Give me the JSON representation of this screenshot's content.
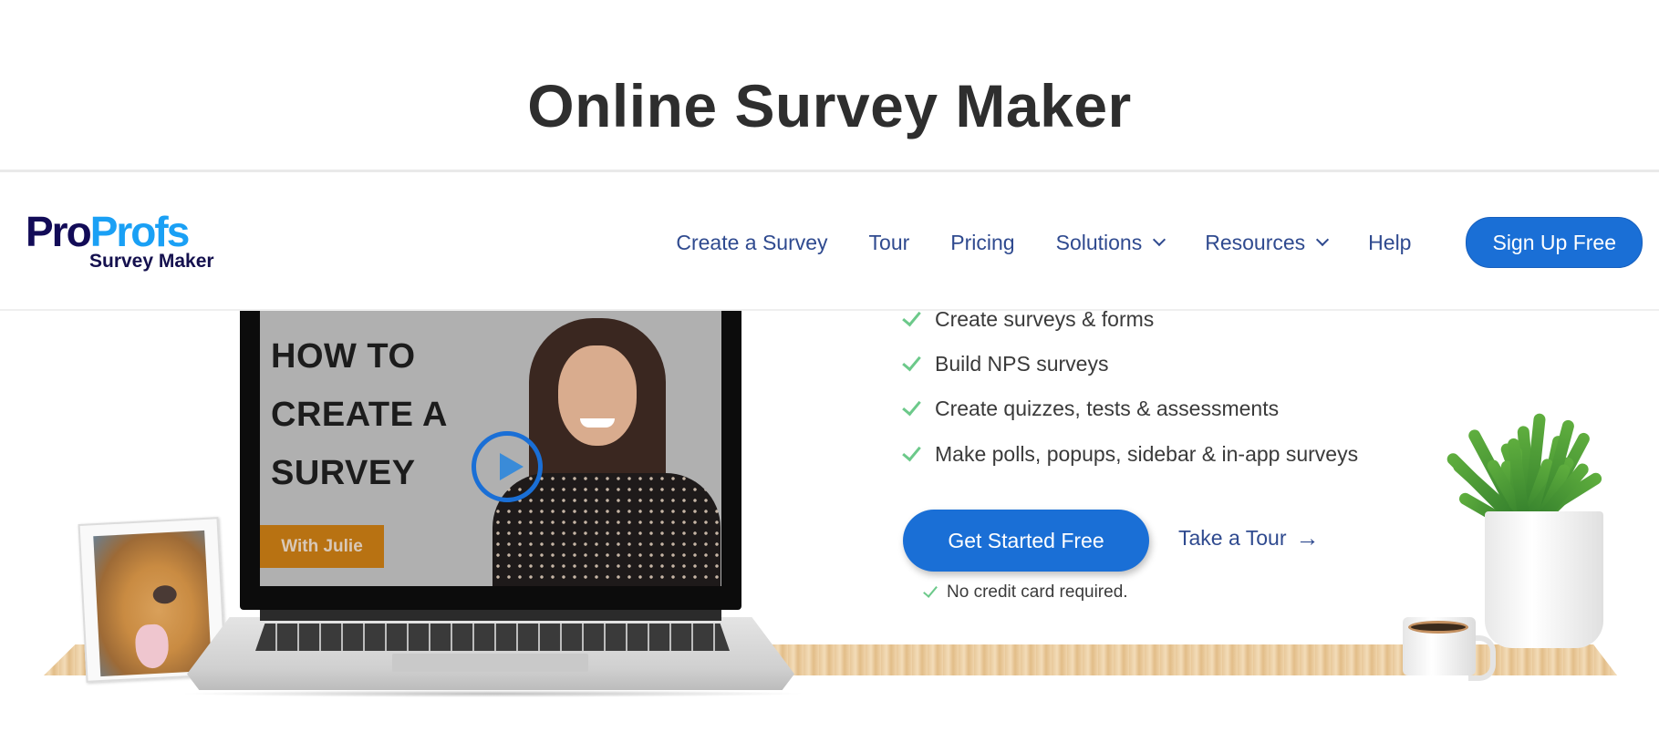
{
  "page": {
    "title": "Online Survey Maker"
  },
  "header": {
    "logo": {
      "part1": "Pro",
      "part2": "Profs",
      "subtitle": "Survey Maker"
    },
    "nav": [
      {
        "label": "Create a Survey",
        "dropdown": false
      },
      {
        "label": "Tour",
        "dropdown": false
      },
      {
        "label": "Pricing",
        "dropdown": false
      },
      {
        "label": "Solutions",
        "dropdown": true
      },
      {
        "label": "Resources",
        "dropdown": true
      },
      {
        "label": "Help",
        "dropdown": false
      }
    ],
    "signup_label": "Sign Up Free"
  },
  "hero": {
    "video": {
      "title_lines": [
        "HOW TO",
        "CREATE A",
        "SURVEY"
      ],
      "badge": "With Julie",
      "play_icon": "play-icon"
    },
    "features": [
      "Create surveys & forms",
      "Build NPS surveys",
      "Create quizzes, tests & assessments",
      "Make polls, popups, sidebar & in-app surveys"
    ],
    "cta_label": "Get Started Free",
    "tour_label": "Take a Tour",
    "tour_arrow": "→",
    "no_credit_card": "No credit card required."
  },
  "colors": {
    "brand_dark": "#120b57",
    "brand_light": "#1aa0f5",
    "primary_button": "#1a6fd6",
    "nav_text": "#2f4a8f",
    "check_green": "#6cc98a",
    "title_text": "#2e2e2e"
  }
}
